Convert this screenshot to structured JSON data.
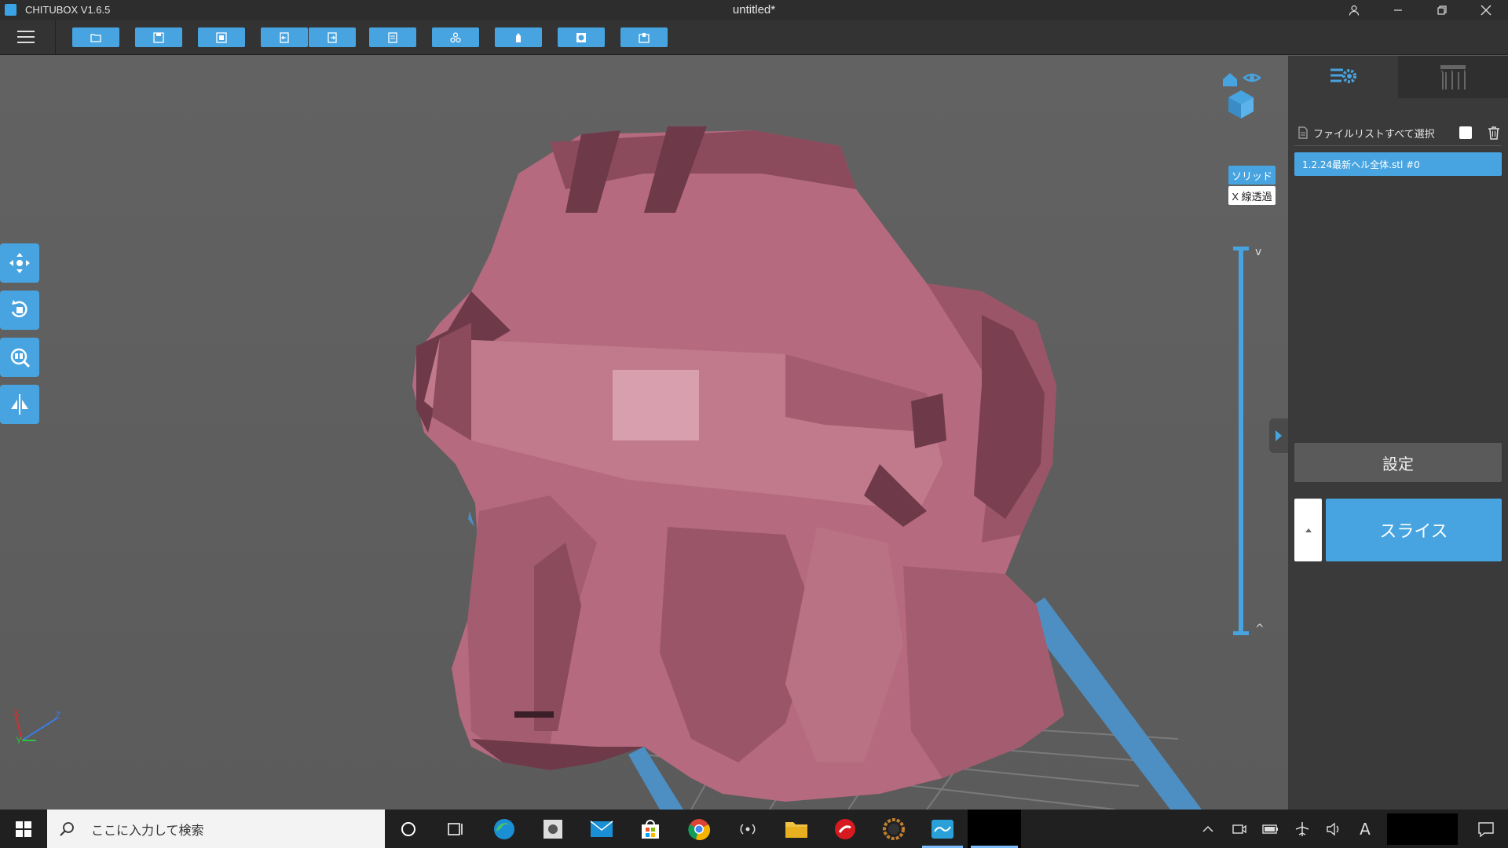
{
  "app": {
    "name": "CHITUBOX V1.6.5",
    "window_title": "untitled*",
    "colors": {
      "accent": "#47a4e0",
      "model": "#b56a7f",
      "background": "#5f5f5f"
    }
  },
  "window_controls": {
    "user_icon": "user-icon",
    "minimize_icon": "minimize-icon",
    "restore_icon": "restore-icon",
    "close_icon": "close-icon"
  },
  "toolbar": {
    "menu_icon": "hamburger-menu-icon",
    "buttons": [
      "open-file-icon",
      "save-icon",
      "screenshot-icon",
      "undo-icon",
      "redo-icon",
      "layout-icon",
      "multi-copy-icon",
      "support-icon",
      "hollow-icon",
      "dig-hole-icon"
    ]
  },
  "viewport": {
    "left_tools": [
      "move-icon",
      "rotate-icon",
      "scale-icon",
      "mirror-icon"
    ],
    "view_cube": {
      "home_icon": "home-icon",
      "eye_icon": "eye-icon",
      "cube_icon": "view-cube-icon"
    },
    "render_mode": {
      "solid": "ソリッド",
      "xray": "X 線透過"
    },
    "layer_slider": {
      "up": "^",
      "down": "v"
    },
    "axes": {
      "x": "X",
      "y": "Y",
      "z": "Z"
    }
  },
  "right_panel": {
    "tabs": [
      "settings-list-icon",
      "supports-icon"
    ],
    "select_all_label": "ファイルリストすべて選択",
    "files": [
      "1.2.24最新ヘル全体.stl #0"
    ],
    "settings_label": "設定",
    "slice_label": "スライス"
  },
  "taskbar": {
    "search_placeholder": "ここに入力して検索",
    "tray": {
      "ime_label": "A"
    }
  }
}
